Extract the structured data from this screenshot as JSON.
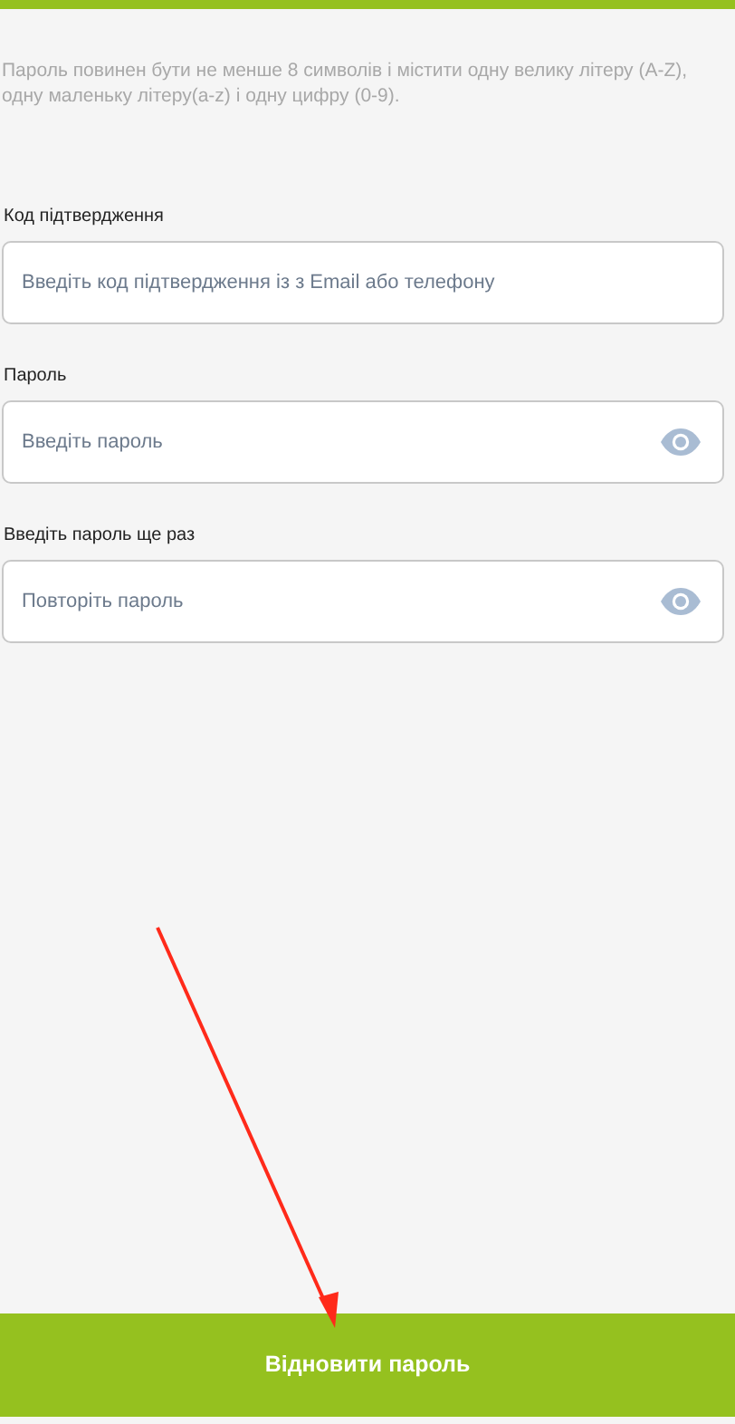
{
  "hint": "Пароль повинен бути не менше 8 символів і містити одну велику літеру (A-Z), одну маленьку літеру(a-z) і одну цифру (0-9).",
  "fields": [
    {
      "label": "Код підтвердження",
      "placeholder": "Введіть код підтвердження із з Email або телефону",
      "kind": "text"
    },
    {
      "label": "Пароль",
      "placeholder": "Введіть пароль",
      "kind": "password"
    },
    {
      "label": "Введіть пароль ще раз",
      "placeholder": "Повторіть пароль",
      "kind": "password"
    }
  ],
  "submit_button": "Відновити пароль"
}
